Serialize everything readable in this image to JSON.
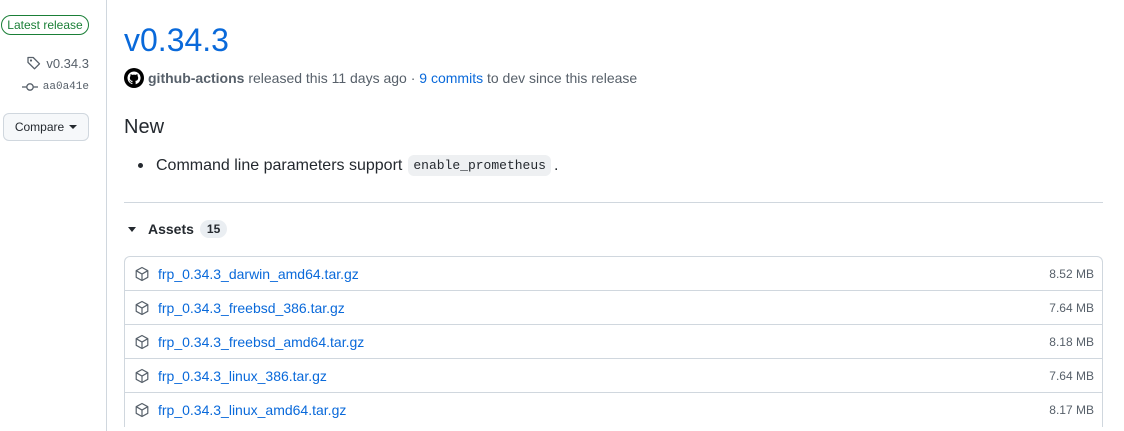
{
  "sidebar": {
    "latest_release": "Latest release",
    "tag": "v0.34.3",
    "commit": "aa0a41e",
    "compare": "Compare"
  },
  "release": {
    "title": "v0.34.3",
    "author": "github-actions",
    "released_text": "released this 11 days ago",
    "separator": "·",
    "commits_link": "9 commits",
    "commits_suffix": "to dev since this release",
    "section_heading": "New",
    "bullet_text": "Command line parameters support",
    "bullet_code": "enable_prometheus",
    "bullet_end": "."
  },
  "assets": {
    "label": "Assets",
    "count": "15",
    "items": [
      {
        "name": "frp_0.34.3_darwin_amd64.tar.gz",
        "size": "8.52 MB"
      },
      {
        "name": "frp_0.34.3_freebsd_386.tar.gz",
        "size": "7.64 MB"
      },
      {
        "name": "frp_0.34.3_freebsd_amd64.tar.gz",
        "size": "8.18 MB"
      },
      {
        "name": "frp_0.34.3_linux_386.tar.gz",
        "size": "7.64 MB"
      },
      {
        "name": "frp_0.34.3_linux_amd64.tar.gz",
        "size": "8.17 MB"
      }
    ]
  },
  "icons": [
    "tag-icon",
    "git-commit-icon",
    "github-avatar-icon",
    "package-icon",
    "triangle-down-icon"
  ]
}
